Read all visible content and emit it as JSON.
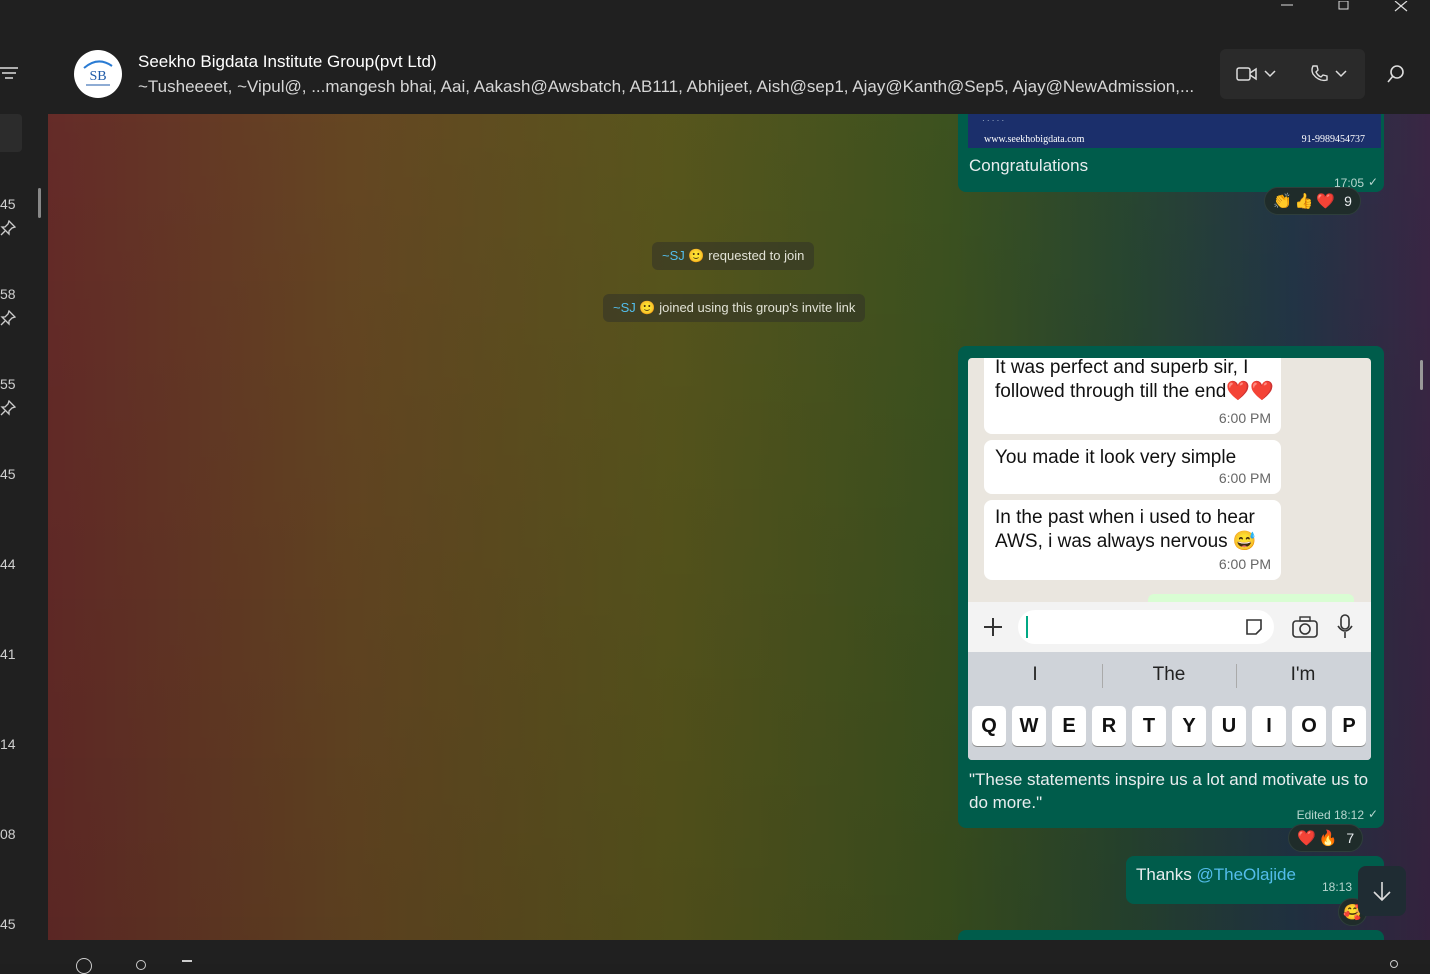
{
  "window": {
    "controls": [
      "minimize-icon",
      "restore-icon",
      "close-icon"
    ]
  },
  "left_strip": {
    "times": [
      "45",
      "58",
      "55",
      "45",
      "44",
      "41",
      "14",
      "08",
      "45"
    ],
    "pinned_rows": [
      0,
      1,
      2
    ]
  },
  "header": {
    "title": "Seekho Bigdata Institute Group(pvt Ltd)",
    "members": "~Tusheeeet, ~Vipul@, ...mangesh bhai, Aai, Aakash@Awsbatch, AB111, Abhijeet, Aish@sep1, Ajay@Kanth@Sep5, Ajay@NewAdmission,...",
    "avatar_text": "SB"
  },
  "messages": {
    "congrats": {
      "image_footer_site": "www.seekhobigdata.com",
      "image_footer_phone": "91-9989454737",
      "text": "Congratulations",
      "time": "17:05",
      "reactions": [
        "👏",
        "👍",
        "❤️"
      ],
      "reaction_count": "9"
    },
    "system1": {
      "who": "~SJ",
      "emoji": "🙂",
      "text": "requested to join"
    },
    "system2": {
      "who": "~SJ",
      "emoji": "🙂",
      "text": "joined using this group's invite link"
    },
    "screenshot_msg": {
      "phone_msgs": [
        {
          "text": "It was perfect and superb sir, I followed through till the end❤️❤️",
          "time": "6:00 PM"
        },
        {
          "text": "You made it look very simple",
          "time": "6:00 PM"
        },
        {
          "text": "In the past when i used to hear AWS, i was always nervous 😅",
          "time": "6:00 PM"
        }
      ],
      "suggestions": [
        "I",
        "The",
        "I'm"
      ],
      "keys": [
        "Q",
        "W",
        "E",
        "R",
        "T",
        "Y",
        "U",
        "I",
        "O",
        "P"
      ],
      "caption": "\"These statements inspire us a lot and motivate us to do more.\"",
      "time": "Edited 18:12",
      "reactions": [
        "❤️",
        "🔥"
      ],
      "reaction_count": "7"
    },
    "thanks": {
      "text": "Thanks",
      "mention": "@TheOlajide",
      "time": "18:13",
      "reaction": "🥰"
    }
  },
  "colors": {
    "outgoing_bubble": "#005c4b",
    "mention": "#53bdeb",
    "app_bg": "#202020"
  }
}
